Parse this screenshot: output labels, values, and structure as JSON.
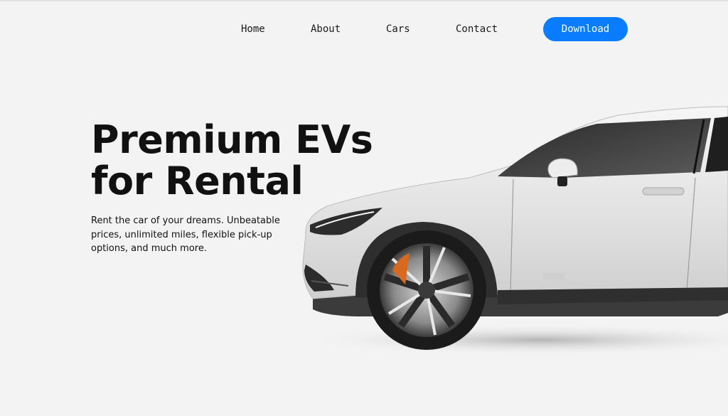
{
  "nav": {
    "items": [
      {
        "label": "Home"
      },
      {
        "label": "About"
      },
      {
        "label": "Cars"
      },
      {
        "label": "Contact"
      }
    ],
    "download_label": "Download"
  },
  "hero": {
    "title_line1": "Premium EVs",
    "title_line2": "for Rental",
    "subtitle": "Rent the car of your dreams. Unbeatable prices, unlimited miles, flexible pick-up options, and much more."
  },
  "colors": {
    "background": "#f3f3f3",
    "accent": "#0a7cff",
    "text": "#111111",
    "car_body": "#e4e4e4"
  },
  "images": {
    "hero_car": "white-electric-car-side-view"
  }
}
